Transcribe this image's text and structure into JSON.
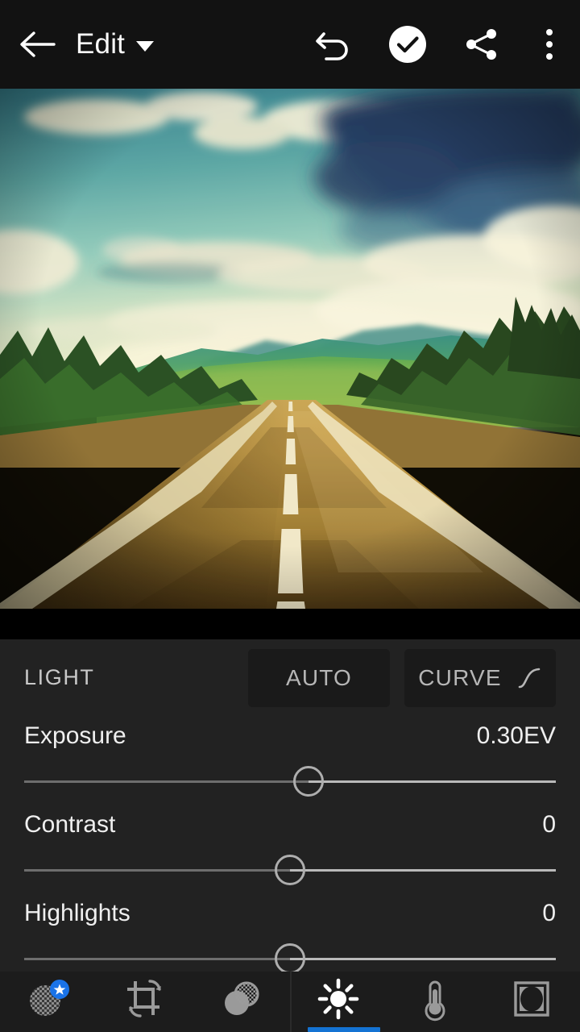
{
  "app": {
    "screen_title": "Edit",
    "theme_bg": "#222222",
    "header_bg": "#121212",
    "accent_color": "#1473d3",
    "badge_color": "#1a73e8"
  },
  "header": {
    "back_label": "Back",
    "title": "Edit",
    "dropdown_icon": "chevron-down-icon",
    "actions": [
      {
        "name": "undo-button",
        "icon": "undo-icon",
        "label": "Undo"
      },
      {
        "name": "confirm-button",
        "icon": "check-circle-icon",
        "label": "Done"
      },
      {
        "name": "share-button",
        "icon": "share-icon",
        "label": "Share"
      },
      {
        "name": "overflow-menu-button",
        "icon": "more-vertical-icon",
        "label": "More options"
      }
    ]
  },
  "photo": {
    "alt": "Empty asphalt highway with dashed center line receding toward green hills under a teal sky with dramatic clouds",
    "sky_top": "#2f7f96",
    "sky_mid": "#7cc6c2",
    "sky_low": "#f3f0d2",
    "cloud_dark": "#1b3a6b",
    "cloud_light": "#f6f4e2",
    "hill_color": "#3f9e7a",
    "tree_color": "#20481f",
    "road_color": "#b08a3e",
    "road_dark": "#503a18",
    "line_color": "#f2ecd0"
  },
  "light_section": {
    "title": "LIGHT",
    "auto_button": "AUTO",
    "curve_button": "CURVE",
    "curve_icon": "tone-curve-icon"
  },
  "sliders": [
    {
      "name": "Exposure",
      "value": "0.30EV",
      "thumb_percent": 53.5
    },
    {
      "name": "Contrast",
      "value": "0",
      "thumb_percent": 50
    },
    {
      "name": "Highlights",
      "value": "0",
      "thumb_percent": 50
    }
  ],
  "bottom_tabs": [
    {
      "label": "Presets",
      "icon": "presets-circle-icon",
      "active": false,
      "badge": "star"
    },
    {
      "label": "Crop",
      "icon": "crop-rotate-icon",
      "active": false
    },
    {
      "label": "Selective",
      "icon": "selective-circles-icon",
      "active": false
    },
    {
      "label": "Light",
      "icon": "sun-icon",
      "active": true
    },
    {
      "label": "Color",
      "icon": "thermometer-icon",
      "active": false
    },
    {
      "label": "Effects",
      "icon": "vignette-frame-icon",
      "active": false
    }
  ]
}
